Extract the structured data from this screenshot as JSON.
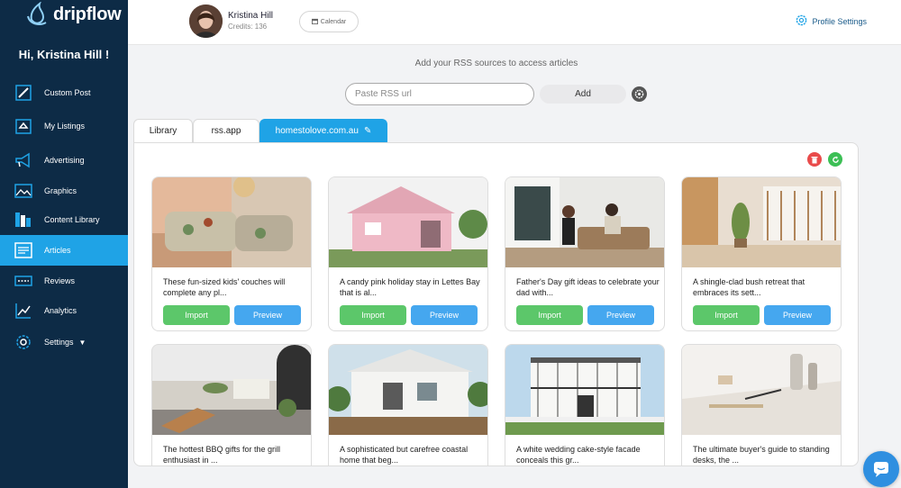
{
  "brand": {
    "name": "dripflow"
  },
  "sidebar": {
    "greeting": "Hi, Kristina Hill !",
    "items": [
      {
        "label": "Custom Post",
        "icon": "edit-icon"
      },
      {
        "label": "My Listings",
        "icon": "listings-icon"
      },
      {
        "label": "Advertising",
        "icon": "megaphone-icon"
      },
      {
        "label": "Graphics",
        "icon": "image-icon"
      },
      {
        "label": "Content Library",
        "icon": "library-icon"
      },
      {
        "label": "Articles",
        "icon": "articles-icon",
        "active": true
      },
      {
        "label": "Reviews",
        "icon": "reviews-icon"
      },
      {
        "label": "Analytics",
        "icon": "analytics-icon"
      },
      {
        "label": "Settings",
        "icon": "settings-icon",
        "has_dropdown": true
      }
    ]
  },
  "header": {
    "user_name": "Kristina Hill",
    "credits": "Credits: 136",
    "calendar_label": "Calendar",
    "profile_settings_label": "Profile Settings"
  },
  "rss": {
    "hint": "Add your RSS sources to access articles",
    "placeholder": "Paste RSS url",
    "add_label": "Add"
  },
  "tabs": [
    {
      "label": "Library"
    },
    {
      "label": "rss.app"
    },
    {
      "label": "homestolove.com.au",
      "active": true
    }
  ],
  "buttons": {
    "import": "Import",
    "preview": "Preview"
  },
  "articles": [
    {
      "title": "These fun-sized kids' couches will complete any pl..."
    },
    {
      "title": "A candy pink holiday stay in Lettes Bay that is al..."
    },
    {
      "title": "Father's Day gift ideas to celebrate your dad with..."
    },
    {
      "title": "A shingle-clad bush retreat that embraces its sett..."
    },
    {
      "title": "The hottest BBQ gifts for the grill enthusiast in ..."
    },
    {
      "title": "A sophisticated but carefree coastal home that beg..."
    },
    {
      "title": "A white wedding cake-style facade conceals this gr..."
    },
    {
      "title": "The ultimate buyer's guide to standing desks, the ..."
    }
  ],
  "colors": {
    "sidebar_bg": "#0d2b46",
    "accent": "#1fa3e6",
    "import_green": "#5cc76a",
    "preview_blue": "#45a7ef",
    "delete_red": "#e94b4b",
    "refresh_green": "#3cbf55"
  }
}
